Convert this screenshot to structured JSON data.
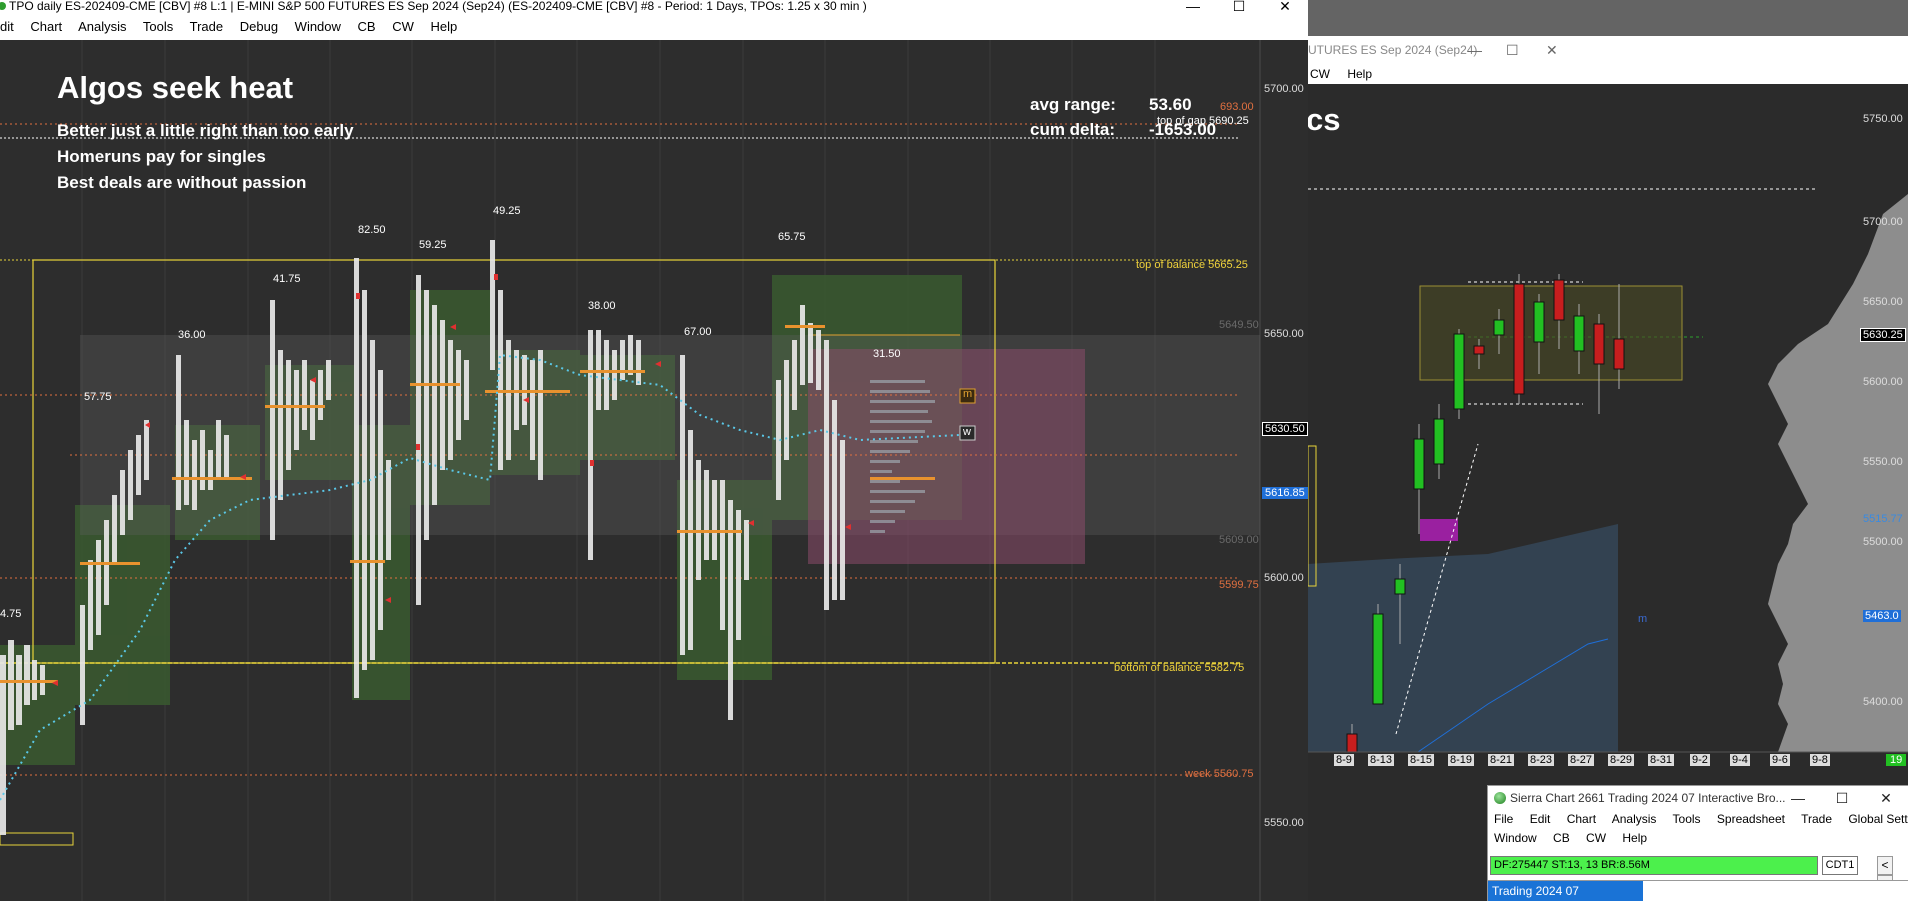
{
  "main_window": {
    "title": "TPO daily ES-202409-CME [CBV] #8 L:1 | E-MINI S&P 500 FUTURES ES Sep 2024 (Sep24) (ES-202409-CME [CBV] #8 - Period: 1 Days, TPOs: 1.25 x 30 min  )",
    "controls": {
      "minimize": "—",
      "maximize": "☐",
      "close": "✕"
    },
    "menu": [
      "dit",
      "Chart",
      "Analysis",
      "Tools",
      "Trade",
      "Debug",
      "Window",
      "CB",
      "CW",
      "Help"
    ]
  },
  "chart_overlay": {
    "headline": "Algos seek heat",
    "quotes": [
      "Better just a little right than too early",
      "Homeruns pay for singles",
      "Best deals are without passion"
    ],
    "avg_range_label": "avg range:",
    "avg_range_value": "53.60",
    "cum_delta_label": "cum delta:",
    "cum_delta_value": "-1653.00"
  },
  "price_axis": {
    "ticks": [
      "5700.00",
      "5650.00",
      "5600.00",
      "5550.00"
    ],
    "current_price": "5630.50",
    "blue_marker": "5616.85",
    "colors": {
      "current": "#ffffff",
      "marker": "#1f6fd8"
    }
  },
  "level_labels": [
    {
      "text": "693.00",
      "color": "#e0703a"
    },
    {
      "text": "top of gap  5690.25",
      "color": "#ffffff"
    },
    {
      "text": "top of balance  5665.25",
      "color": "#f0d23c"
    },
    {
      "text": "5649.50",
      "color": "#6a6a6a"
    },
    {
      "text": "5609.00",
      "color": "#6a6a6a"
    },
    {
      "text": "5599.75",
      "color": "#e0703a"
    },
    {
      "text": "bottom of balance  5582.75",
      "color": "#f0d23c"
    },
    {
      "text": "week  5560.75",
      "color": "#e0703a"
    }
  ],
  "day_ranges": [
    {
      "text": "4.75"
    },
    {
      "text": "57.75"
    },
    {
      "text": "36.00"
    },
    {
      "text": "41.75"
    },
    {
      "text": "82.50"
    },
    {
      "text": "59.25"
    },
    {
      "text": "49.25"
    },
    {
      "text": "38.00"
    },
    {
      "text": "67.00"
    },
    {
      "text": "65.75"
    },
    {
      "text": "31.50"
    }
  ],
  "profile_markers": {
    "m": "m",
    "w": "w"
  },
  "right_window": {
    "title": "UTURES ES Sep 2024 (Sep24)",
    "menu": [
      "CW",
      "Help"
    ],
    "big_text": "cs",
    "price_ticks": [
      "5750.00",
      "5700.00",
      "5650.00",
      "5600.00",
      "5550.00",
      "5500.00",
      "5400.00"
    ],
    "current_price": "5630.25",
    "blue_label": "5515.77",
    "lower_blue_label": "5463.0",
    "m_marker": "m",
    "date_labels": [
      "8-9",
      "8-13",
      "8-15",
      "8-19",
      "8-21",
      "8-23",
      "8-27",
      "8-29",
      "8-31",
      "9-2",
      "9-4",
      "9-6",
      "9-8"
    ],
    "corner_badge": "19"
  },
  "sierra_window": {
    "title": "Sierra Chart 2661 Trading 2024 07 Interactive Bro...",
    "menu_row1": [
      "File",
      "Edit",
      "Chart",
      "Analysis",
      "Tools",
      "Spreadsheet",
      "Trade",
      "Global Settings"
    ],
    "menu_row2": [
      "Window",
      "CB",
      "CW",
      "Help"
    ],
    "status": "DF:275447  ST:13, 13  BR:8.56M",
    "cdt": "CDT1",
    "arrow_left": "<",
    "arrow_right": ">",
    "tab": "Trading 2024 07"
  }
}
